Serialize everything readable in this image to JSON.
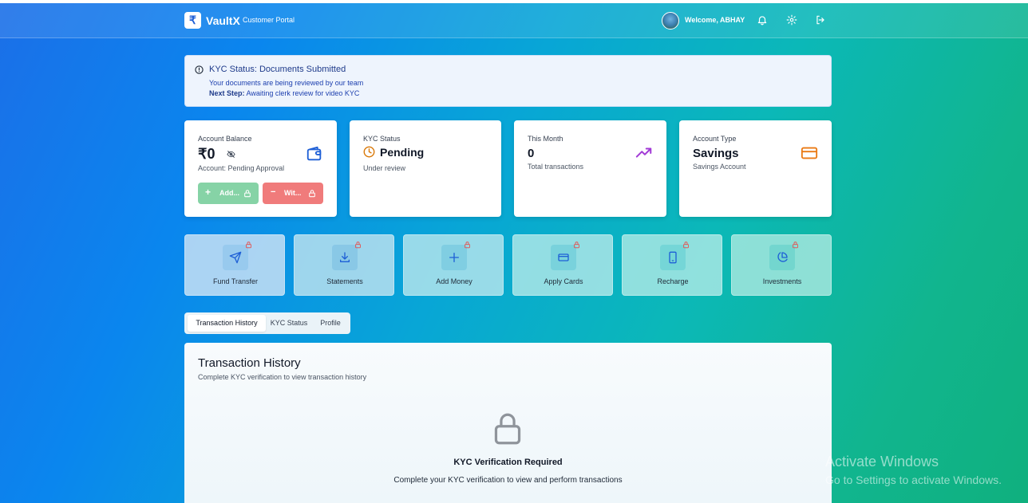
{
  "navbar": {
    "logo_glyph": "₹",
    "brand": "VaultX",
    "subtitle": "Customer Portal",
    "welcome": "Welcome, ABHAY",
    "icons": [
      "bell-icon",
      "gear-icon",
      "logout-icon"
    ]
  },
  "alert": {
    "title": "KYC Status: Documents Submitted",
    "line1": "Your documents are being reviewed by our team",
    "next_step_label": "Next Step:",
    "next_step_text": "Awaiting clerk review for video KYC"
  },
  "cards": {
    "balance": {
      "label": "Account Balance",
      "value": "₹0",
      "sub": "Account: Pending Approval",
      "add_label": "Add...",
      "withdraw_label": "Wit..."
    },
    "kyc": {
      "label": "KYC Status",
      "value": "Pending",
      "sub": "Under review"
    },
    "month": {
      "label": "This Month",
      "value": "0",
      "sub": "Total transactions"
    },
    "account_type": {
      "label": "Account Type",
      "value": "Savings",
      "sub": "Savings Account"
    }
  },
  "actions": [
    {
      "label": "Fund Transfer",
      "icon": "send-icon"
    },
    {
      "label": "Statements",
      "icon": "download-icon"
    },
    {
      "label": "Add Money",
      "icon": "plus-icon"
    },
    {
      "label": "Apply Cards",
      "icon": "card-icon"
    },
    {
      "label": "Recharge",
      "icon": "phone-icon"
    },
    {
      "label": "Investments",
      "icon": "pie-chart-icon"
    }
  ],
  "tabs": [
    "Transaction History",
    "KYC Status",
    "Profile"
  ],
  "panel": {
    "title": "Transaction History",
    "subtitle": "Complete KYC verification to view transaction history",
    "required": "KYC Verification Required",
    "description": "Complete your KYC verification to view and perform transactions"
  },
  "watermark": {
    "title": "Activate Windows",
    "subtitle": "Go to Settings to activate Windows."
  },
  "colors": {
    "add_button": "#86d3a6",
    "withdraw_button": "#f07b7b",
    "wallet_icon": "#1e5fd6",
    "pending_icon": "#d97706",
    "trend_icon": "#a23ad6",
    "card_icon": "#ea7a14"
  }
}
